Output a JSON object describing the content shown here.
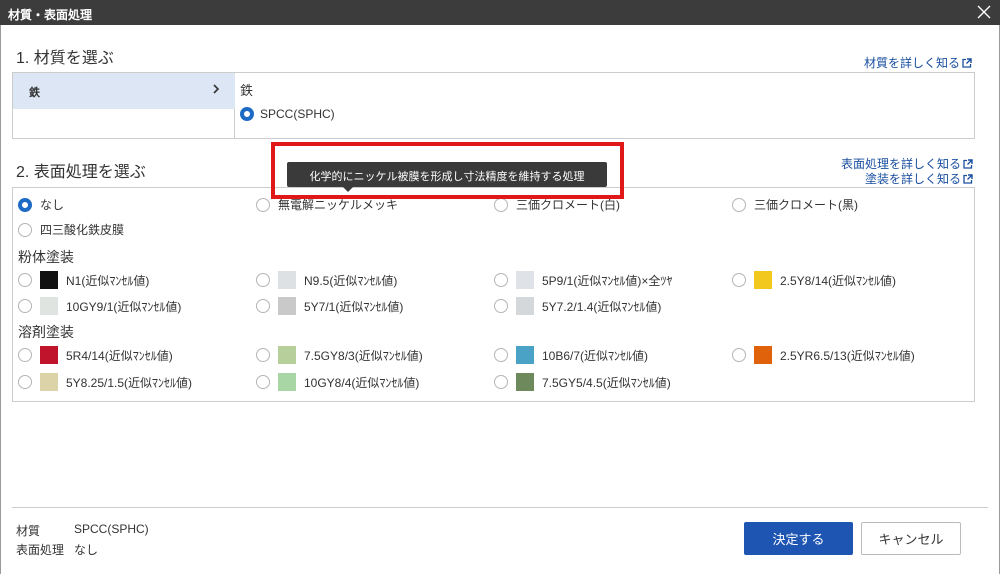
{
  "window": {
    "title": "材質・表面処理"
  },
  "material": {
    "section_title": "1. 材質を選ぶ",
    "more_link": "材質を詳しく知る",
    "category": "鉄",
    "selected_category_title": "鉄",
    "option": "SPCC(SPHC)"
  },
  "surface": {
    "section_title": "2. 表面処理を選ぶ",
    "more_link_1": "表面処理を詳しく知る",
    "more_link_2": "塗装を詳しく知る",
    "basic": {
      "none": "なし",
      "nickel": "無電解ニッケルメッキ",
      "chromate_white": "三価クロメート(白)",
      "chromate_black": "三価クロメート(黒)",
      "triiron": "四三酸化鉄皮膜"
    },
    "powder_title": "粉体塗装",
    "powder": {
      "p1": "N1(近似ﾏﾝｾﾙ値)",
      "p2": "N9.5(近似ﾏﾝｾﾙ値)",
      "p3": "5P9/1(近似ﾏﾝｾﾙ値)×全ﾂﾔ",
      "p4": "2.5Y8/14(近似ﾏﾝｾﾙ値)",
      "p5": "10GY9/1(近似ﾏﾝｾﾙ値)",
      "p6": "5Y7/1(近似ﾏﾝｾﾙ値)",
      "p7": "5Y7.2/1.4(近似ﾏﾝｾﾙ値)"
    },
    "solvent_title": "溶剤塗装",
    "solvent": {
      "s1": "5R4/14(近似ﾏﾝｾﾙ値)",
      "s2": "7.5GY8/3(近似ﾏﾝｾﾙ値)",
      "s3": "10B6/7(近似ﾏﾝｾﾙ値)",
      "s4": "2.5YR6.5/13(近似ﾏﾝｾﾙ値)",
      "s5": "5Y8.25/1.5(近似ﾏﾝｾﾙ値)",
      "s6": "10GY8/4(近似ﾏﾝｾﾙ値)",
      "s7": "7.5GY5/4.5(近似ﾏﾝｾﾙ値)"
    },
    "swatch_colors": {
      "p1": "#111111",
      "p2": "#dde1e4",
      "p3": "#dfe2e7",
      "p4": "#f3c81e",
      "p5": "#dfe4e0",
      "p6": "#c9c9c9",
      "p7": "#d5d8da",
      "s1": "#c0132c",
      "s2": "#b7cf9b",
      "s3": "#4aa3c6",
      "s4": "#e0620b",
      "s5": "#dcd3a8",
      "s6": "#a9d6a5",
      "s7": "#6e8a5c"
    }
  },
  "tooltip": {
    "text": "化学的にニッケル被膜を形成し寸法精度を維持する処理"
  },
  "summary": {
    "material_label": "材質",
    "material_value": "SPCC(SPHC)",
    "surface_label": "表面処理",
    "surface_value": "なし"
  },
  "buttons": {
    "confirm": "決定する",
    "cancel": "キャンセル"
  },
  "colors": {
    "accent": "#1e55b3",
    "highlight": "#e01818",
    "selected_row": "#dce6f5"
  }
}
